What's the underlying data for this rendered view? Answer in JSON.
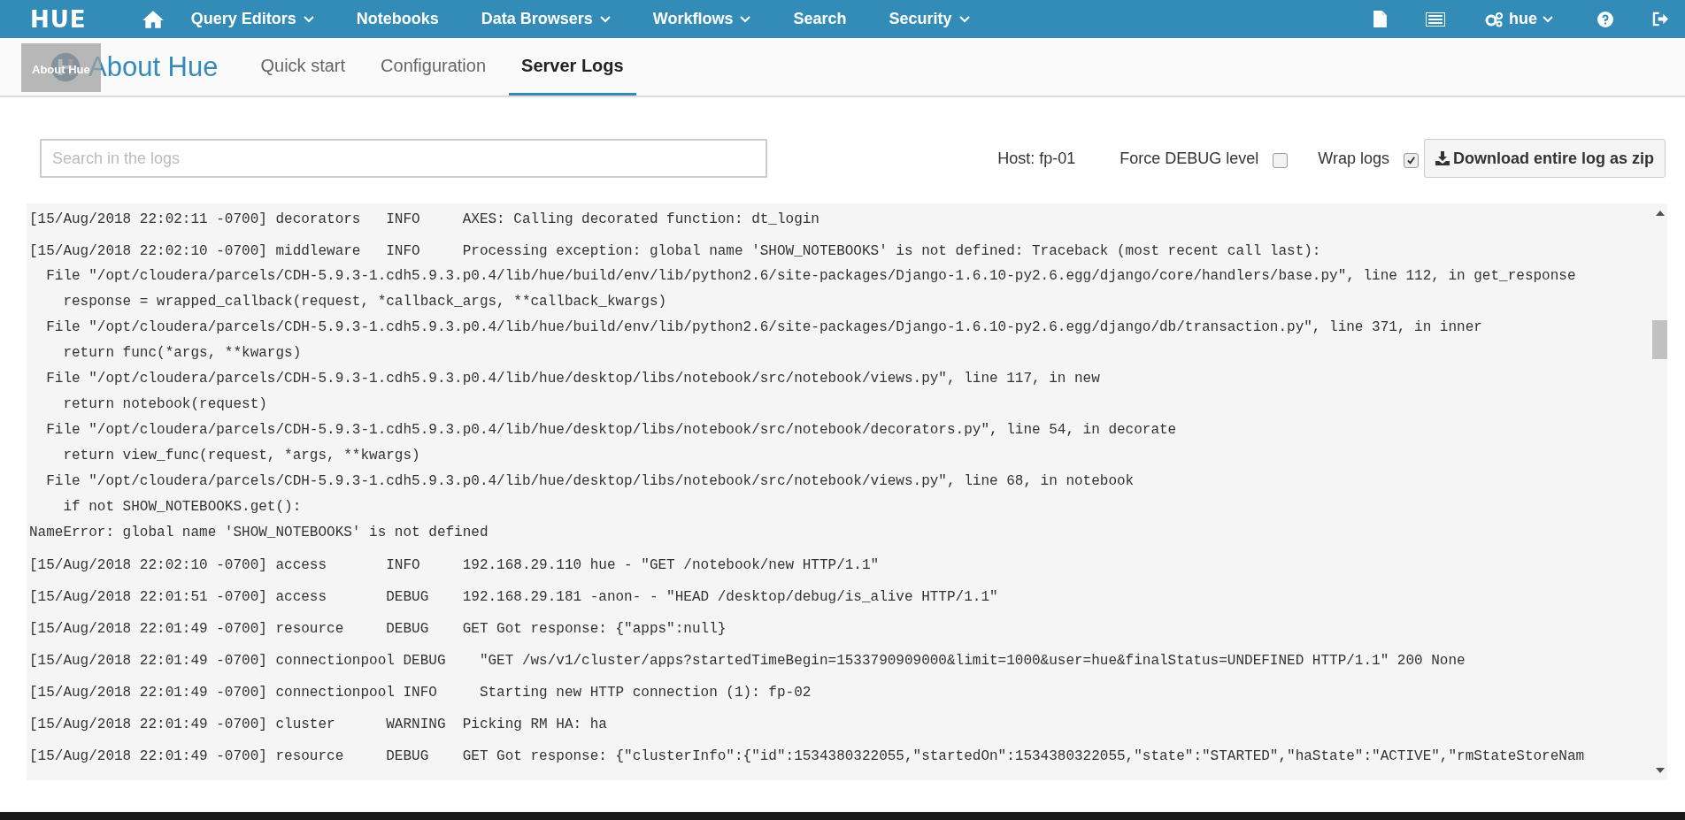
{
  "navbar": {
    "logo": "HUE",
    "items": [
      {
        "label": "Query Editors",
        "dropdown": true
      },
      {
        "label": "Notebooks",
        "dropdown": false
      },
      {
        "label": "Data Browsers",
        "dropdown": true
      },
      {
        "label": "Workflows",
        "dropdown": true
      },
      {
        "label": "Search",
        "dropdown": false
      },
      {
        "label": "Security",
        "dropdown": true
      }
    ],
    "user": "hue"
  },
  "header": {
    "title": "About Hue",
    "drag_ghost": "About Hue",
    "tabs": [
      {
        "label": "Quick start",
        "selected": false
      },
      {
        "label": "Configuration",
        "selected": false
      },
      {
        "label": "Server Logs",
        "selected": true
      }
    ]
  },
  "toolbar": {
    "search": {
      "placeholder": "Search in the logs"
    },
    "host": "Host: fp-01",
    "force_debug": {
      "label": "Force DEBUG level",
      "checked": false
    },
    "wrap_logs": {
      "label": "Wrap logs",
      "checked": true
    },
    "download_button": "Download entire log as zip"
  },
  "log": [
    {
      "line": "[15/Aug/2018 22:02:11 -0700] decorators   INFO     AXES: Calling decorated function: dt_login"
    },
    {
      "line": "[15/Aug/2018 22:02:10 -0700] middleware   INFO     Processing exception: global name 'SHOW_NOTEBOOKS' is not defined: Traceback (most recent call last):",
      "traceback": [
        "  File \"/opt/cloudera/parcels/CDH-5.9.3-1.cdh5.9.3.p0.4/lib/hue/build/env/lib/python2.6/site-packages/Django-1.6.10-py2.6.egg/django/core/handlers/base.py\", line 112, in get_response",
        "    response = wrapped_callback(request, *callback_args, **callback_kwargs)",
        "  File \"/opt/cloudera/parcels/CDH-5.9.3-1.cdh5.9.3.p0.4/lib/hue/build/env/lib/python2.6/site-packages/Django-1.6.10-py2.6.egg/django/db/transaction.py\", line 371, in inner",
        "    return func(*args, **kwargs)",
        "  File \"/opt/cloudera/parcels/CDH-5.9.3-1.cdh5.9.3.p0.4/lib/hue/desktop/libs/notebook/src/notebook/views.py\", line 117, in new",
        "    return notebook(request)",
        "  File \"/opt/cloudera/parcels/CDH-5.9.3-1.cdh5.9.3.p0.4/lib/hue/desktop/libs/notebook/src/notebook/decorators.py\", line 54, in decorate",
        "    return view_func(request, *args, **kwargs)",
        "  File \"/opt/cloudera/parcels/CDH-5.9.3-1.cdh5.9.3.p0.4/lib/hue/desktop/libs/notebook/src/notebook/views.py\", line 68, in notebook",
        "    if not SHOW_NOTEBOOKS.get():",
        "NameError: global name 'SHOW_NOTEBOOKS' is not defined"
      ]
    },
    {
      "line": "[15/Aug/2018 22:02:10 -0700] access       INFO     192.168.29.110 hue - \"GET /notebook/new HTTP/1.1\""
    },
    {
      "line": "[15/Aug/2018 22:01:51 -0700] access       DEBUG    192.168.29.181 -anon- - \"HEAD /desktop/debug/is_alive HTTP/1.1\""
    },
    {
      "line": "[15/Aug/2018 22:01:49 -0700] resource     DEBUG    GET Got response: {\"apps\":null}"
    },
    {
      "line": "[15/Aug/2018 22:01:49 -0700] connectionpool DEBUG    \"GET /ws/v1/cluster/apps?startedTimeBegin=1533790909000&limit=1000&user=hue&finalStatus=UNDEFINED HTTP/1.1\" 200 None"
    },
    {
      "line": "[15/Aug/2018 22:01:49 -0700] connectionpool INFO     Starting new HTTP connection (1): fp-02"
    },
    {
      "line": "[15/Aug/2018 22:01:49 -0700] cluster      WARNING  Picking RM HA: ha"
    },
    {
      "line": "[15/Aug/2018 22:01:49 -0700] resource     DEBUG    GET Got response: {\"clusterInfo\":{\"id\":1534380322055,\"startedOn\":1534380322055,\"state\":\"STARTED\",\"haState\":\"ACTIVE\",\"rmStateStoreNam"
    }
  ]
}
